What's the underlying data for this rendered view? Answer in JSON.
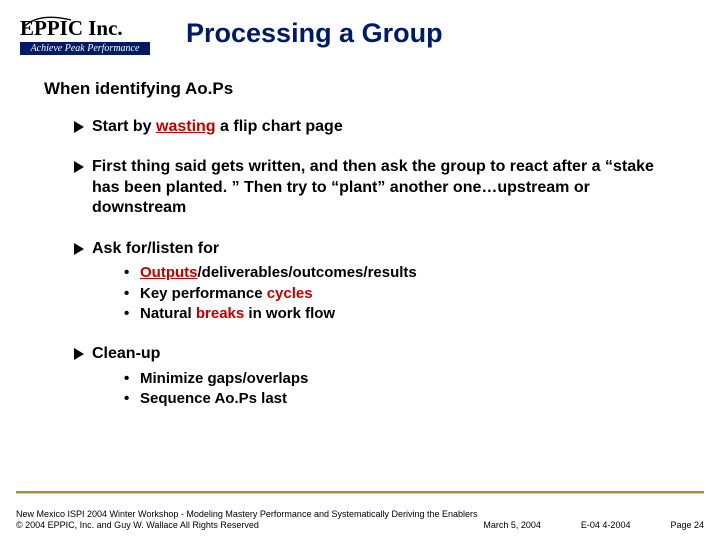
{
  "logo": {
    "name": "EPPIC Inc.",
    "tagline": "Achieve Peak Performance"
  },
  "title": "Processing a Group",
  "intro": "When identifying Ao.Ps",
  "bullets": {
    "b1_pre": "Start by ",
    "b1_hl": "wasting",
    "b1_post": " a flip chart page",
    "b2": "First thing said gets written, and then ask the group to react after a “stake has been planted. ” Then try to “plant” another one…upstream or downstream",
    "b3": "Ask for/listen for",
    "b3_sub": {
      "s1_hl": "Outputs",
      "s1_post": "/deliverables/outcomes/results",
      "s2_pre": "Key performance ",
      "s2_hl": "cycles",
      "s3_pre": "Natural ",
      "s3_hl": "breaks",
      "s3_post": " in work flow"
    },
    "b4": "Clean-up",
    "b4_sub": {
      "s1": "Minimize gaps/overlaps",
      "s2": "Sequence Ao.Ps last"
    }
  },
  "footer": {
    "line1": "New Mexico ISPI 2004 Winter Workshop  -  Modeling Mastery Performance and Systematically Deriving the Enablers",
    "copyright": "© 2004 EPPIC, Inc. and Guy W. Wallace    All Rights Reserved",
    "date": "March 5, 2004",
    "code": "E-04  4-2004",
    "page": "Page 24"
  }
}
